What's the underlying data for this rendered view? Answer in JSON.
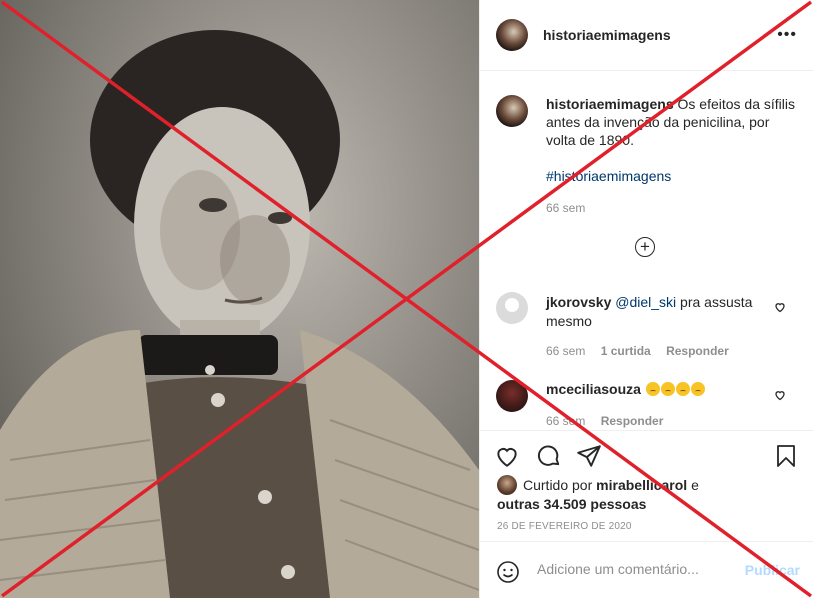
{
  "post": {
    "username": "historiaemimagens",
    "more_label": "•••",
    "caption_username": "historiaemimagens",
    "caption_text": " Os efeitos da sífilis antes da invenção da penicilina, por volta de 1890.",
    "hashtag": "#historiaemimagens",
    "caption_time": "66 sem",
    "load_more_label": "+"
  },
  "comments": [
    {
      "username": "jkorovsky",
      "mention": "@diel_ski",
      "text": " pra assusta mesmo",
      "time": "66 sem",
      "likes": "1 curtida",
      "reply": "Responder"
    },
    {
      "username": "mceciliasouza",
      "emoji": [
        "sad-face",
        "sad-face",
        "sad-face",
        "sad-face"
      ],
      "time": "66 sem",
      "reply": "Responder"
    }
  ],
  "likes": {
    "prefix": "Curtido por ",
    "user": "mirabellicarol",
    "middle": " e",
    "others": "outras 34.509 pessoas"
  },
  "date": "26 DE FEVEREIRO DE 2020",
  "add_comment": {
    "placeholder": "Adicione um comentário...",
    "post_label": "Publicar"
  },
  "colors": {
    "overlay_x": "#e0202a",
    "link": "#00376b",
    "muted": "#8e8e8e",
    "publish_disabled": "#b3dbff"
  },
  "icons": [
    "heart-icon",
    "comment-icon",
    "share-icon",
    "bookmark-icon",
    "emoji-icon",
    "add-comment-icon",
    "more-options-icon"
  ]
}
